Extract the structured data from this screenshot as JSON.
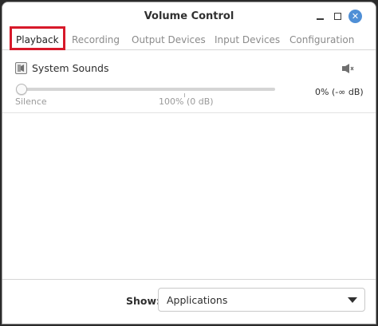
{
  "window": {
    "title": "Volume Control",
    "close_symbol": "✕"
  },
  "tabs": [
    {
      "label": "Playback",
      "active": true
    },
    {
      "label": "Recording",
      "active": false
    },
    {
      "label": "Output Devices",
      "active": false
    },
    {
      "label": "Input Devices",
      "active": false
    },
    {
      "label": "Configuration",
      "active": false
    }
  ],
  "stream": {
    "name": "System Sounds",
    "app_icon": "application-icon",
    "mute_icon": "speaker-muted-icon",
    "volume_fraction": 0.0,
    "volume_readout": "0% (-∞ dB)",
    "marks": {
      "silence": "Silence",
      "hundred": "100% (0 dB)"
    }
  },
  "footer": {
    "show_label": "Show:",
    "show_value": "Applications"
  },
  "colors": {
    "accent": "#3c8ce7",
    "highlight": "#d7192a",
    "close_button": "#4f8fd6"
  }
}
